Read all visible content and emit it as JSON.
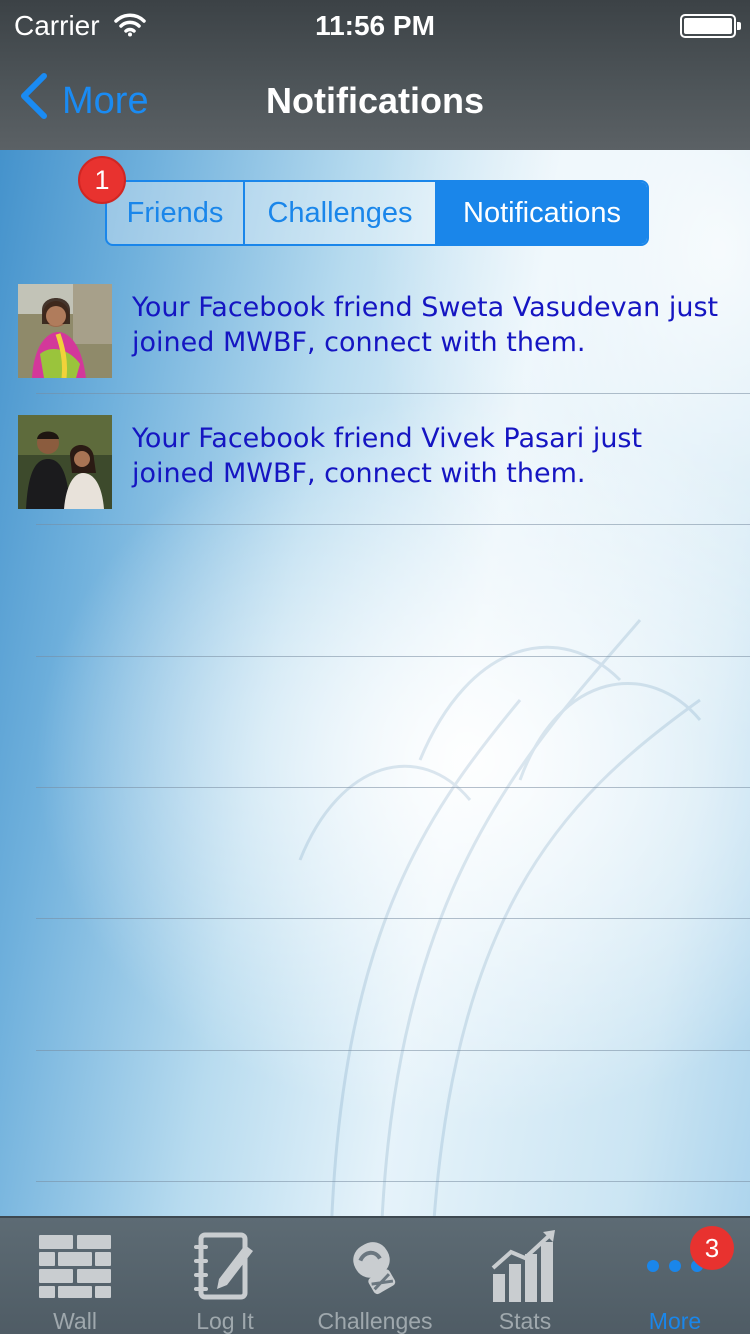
{
  "status_bar": {
    "carrier": "Carrier",
    "time": "11:56 PM"
  },
  "nav": {
    "back_label": "More",
    "title": "Notifications"
  },
  "segments": {
    "friends": "Friends",
    "challenges": "Challenges",
    "notifications": "Notifications",
    "selected": "Notifications",
    "friends_badge": "1"
  },
  "notifications": [
    {
      "message": "Your Facebook friend Sweta Vasudevan just joined MWBF, connect with them."
    },
    {
      "message": "Your Facebook friend Vivek Pasari just joined MWBF, connect with them."
    }
  ],
  "tabbar": {
    "items": [
      {
        "label": "Wall",
        "icon": "brick-wall-icon"
      },
      {
        "label": "Log It",
        "icon": "notebook-pencil-icon"
      },
      {
        "label": "Challenges",
        "icon": "boxing-glove-icon"
      },
      {
        "label": "Stats",
        "icon": "bar-chart-icon"
      },
      {
        "label": "More",
        "icon": "more-dots-icon"
      }
    ],
    "active": "More",
    "more_badge": "3"
  },
  "colors": {
    "accent": "#1a86ea",
    "message_text": "#1515c2",
    "badge": "#e8322f"
  }
}
